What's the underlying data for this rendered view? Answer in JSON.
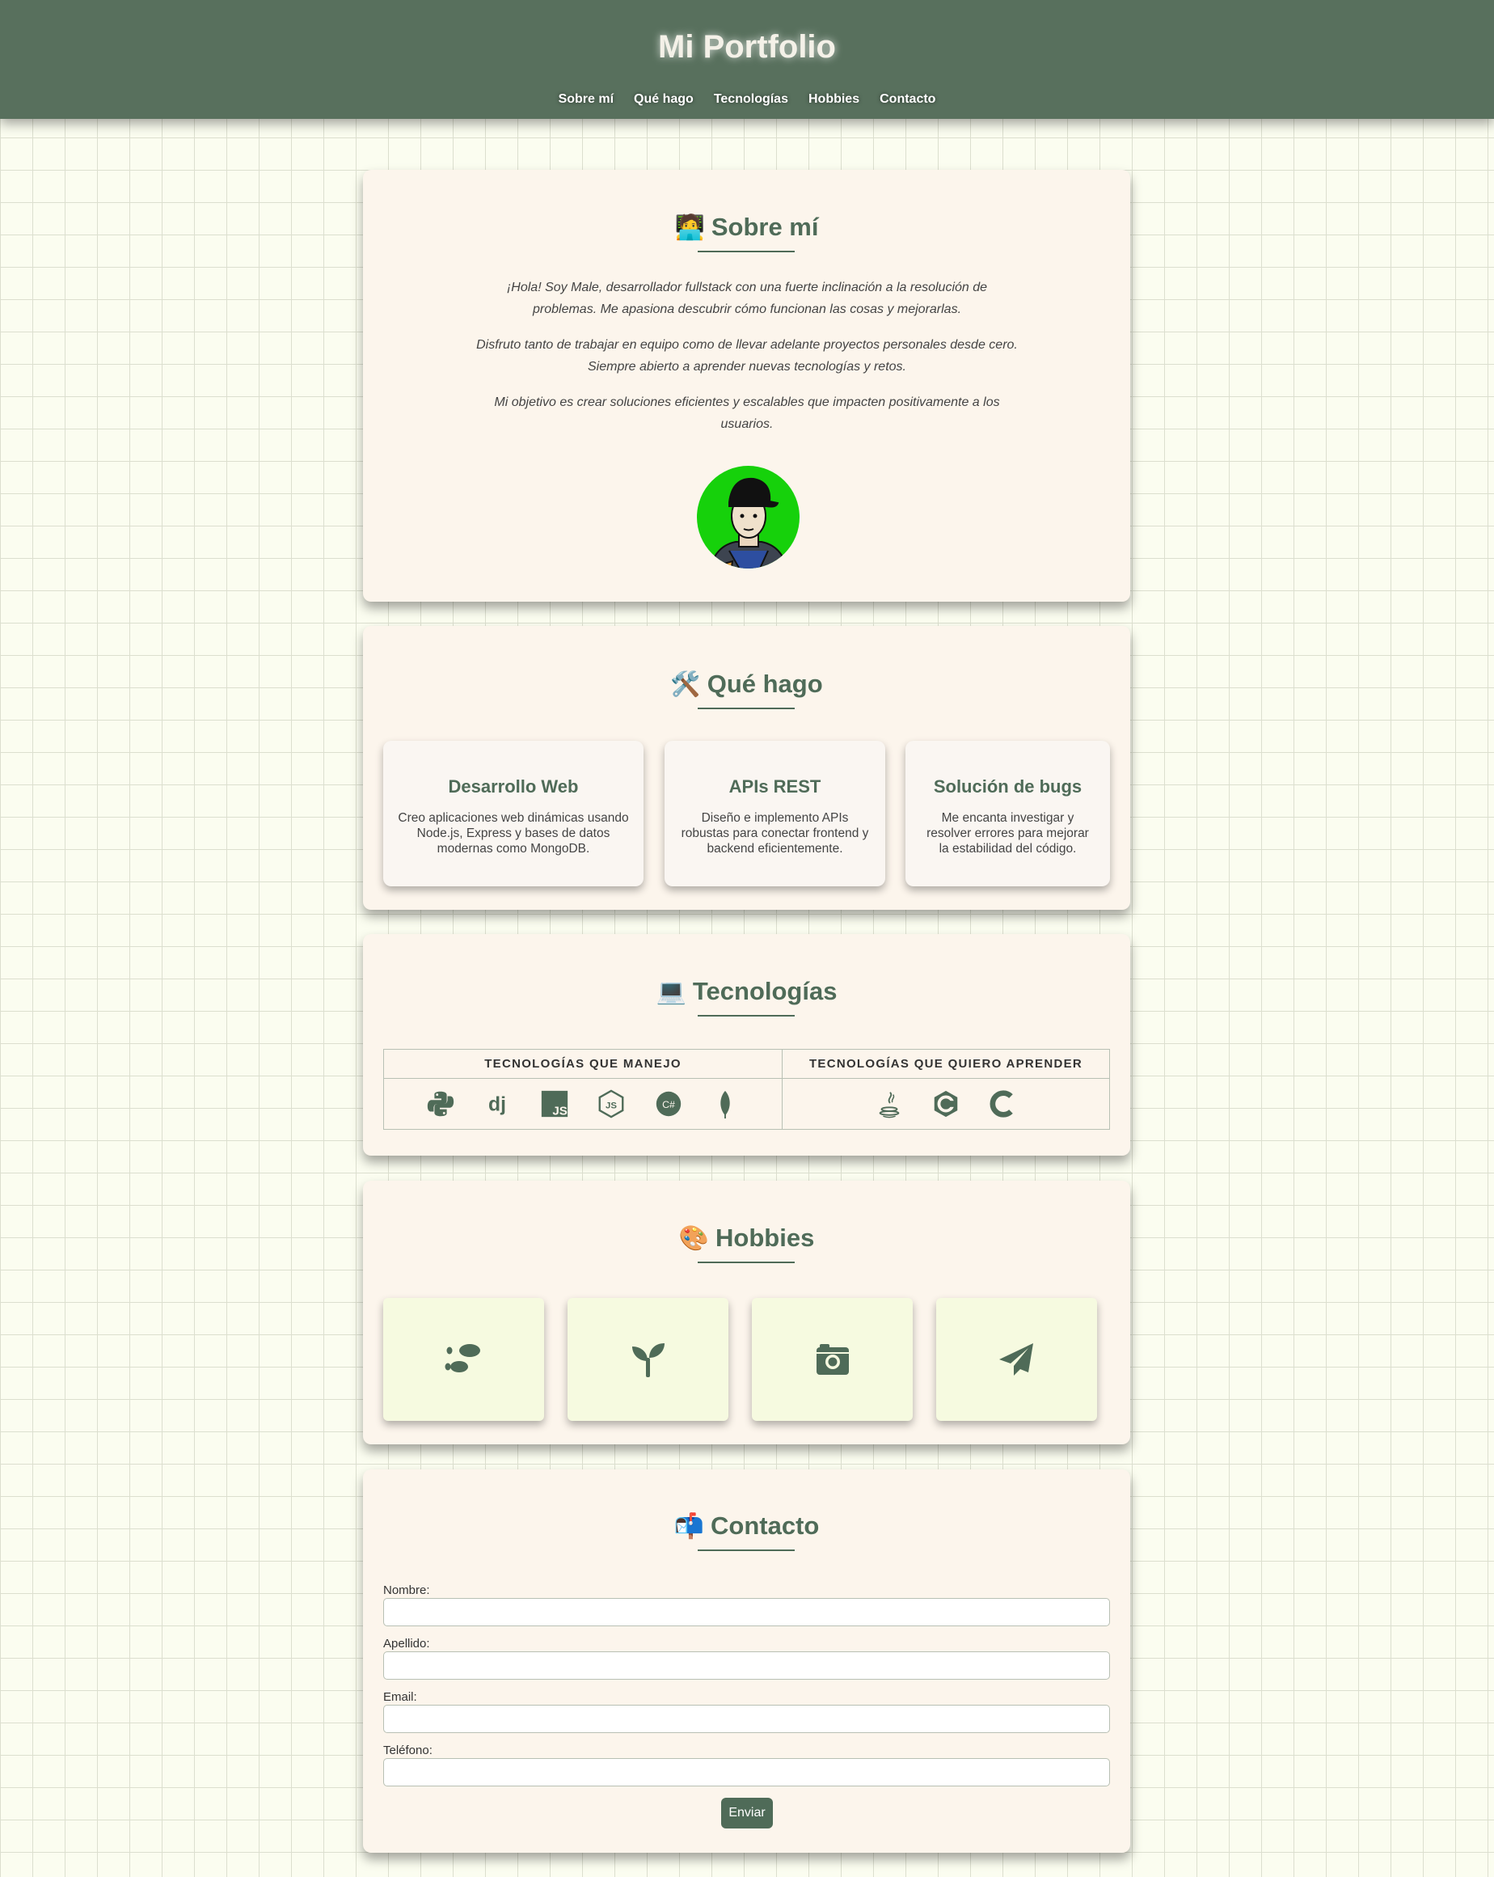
{
  "header": {
    "title": "Mi Portfolio",
    "nav": [
      "Sobre mí",
      "Qué hago",
      "Tecnologías",
      "Hobbies",
      "Contacto"
    ]
  },
  "about": {
    "emoji": "🧑‍💻",
    "title": "Sobre mí",
    "paragraphs": [
      "¡Hola! Soy Male, desarrollador fullstack con una fuerte inclinación a la resolución de problemas. Me apasiona descubrir cómo funcionan las cosas y mejorarlas.",
      "Disfruto tanto de trabajar en equipo como de llevar adelante proyectos personales desde cero. Siempre abierto a aprender nuevas tecnologías y retos.",
      "Mi objetivo es crear soluciones eficientes y escalables que impacten positivamente a los usuarios."
    ]
  },
  "services": {
    "emoji": "🛠️",
    "title": "Qué hago",
    "items": [
      {
        "title": "Desarrollo Web",
        "text": "Creo aplicaciones web dinámicas usando Node.js, Express y bases de datos modernas como MongoDB."
      },
      {
        "title": "APIs REST",
        "text": "Diseño e implemento APIs robustas para conectar frontend y backend eficientemente."
      },
      {
        "title": "Solución de bugs",
        "text": "Me encanta investigar y resolver errores para mejorar la estabilidad del código."
      }
    ]
  },
  "tech": {
    "emoji": "💻",
    "title": "Tecnologías",
    "known_header": "TECNOLOGÍAS QUE MANEJO",
    "learn_header": "TECNOLOGÍAS QUE QUIERO APRENDER",
    "known_icons": [
      "python-icon",
      "django-icon",
      "javascript-icon",
      "nodejs-icon",
      "csharp-icon",
      "mongodb-icon"
    ],
    "known_labels": {
      "django": "dj",
      "javascript": "JS",
      "nodejs": "JS",
      "csharp": "C#"
    },
    "learn_icons": [
      "java-icon",
      "cplusplus-icon",
      "c-icon"
    ]
  },
  "hobbies": {
    "emoji": "🎨",
    "title": "Hobbies",
    "icons": [
      "footprints-icon",
      "seedling-icon",
      "camera-icon",
      "paper-plane-icon"
    ]
  },
  "contact": {
    "emoji": "📬",
    "title": "Contacto",
    "fields": [
      "Nombre:",
      "Apellido:",
      "Email:",
      "Teléfono:"
    ],
    "submit": "Enviar"
  },
  "colors": {
    "header_bg": "#58705d",
    "accent": "#4f6b58",
    "card_bg": "#fcf5ec",
    "page_bg": "#fbfdf0",
    "hobby_bg": "#f6fae0",
    "avatar_bg": "#16d10b"
  }
}
